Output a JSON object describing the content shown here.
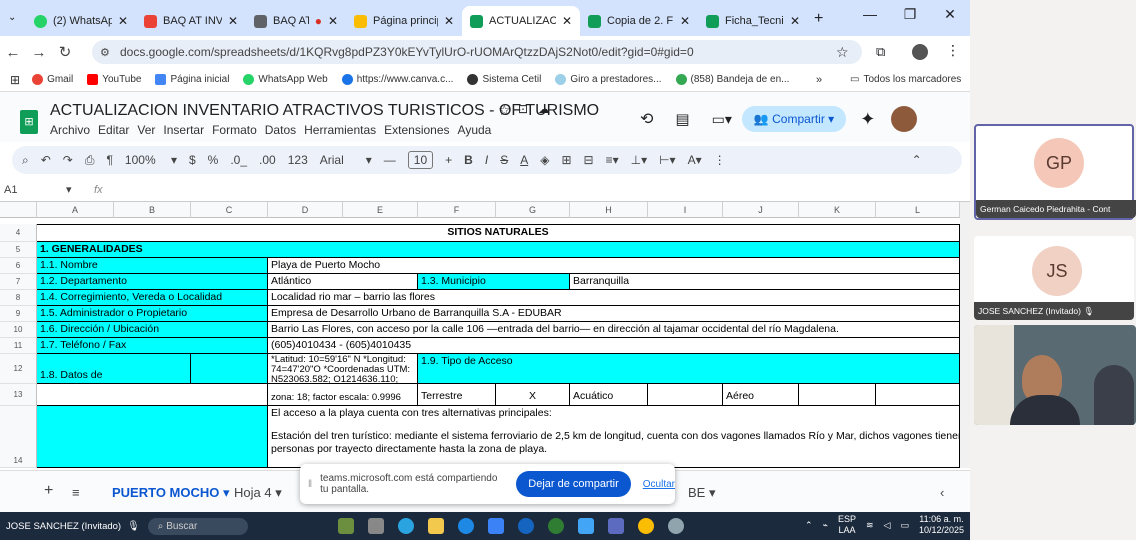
{
  "tabs": [
    {
      "label": "(2) WhatsApp",
      "fav": "#25d366",
      "active": false
    },
    {
      "label": "BAQ AT INVE",
      "fav": "#ea4335",
      "active": false
    },
    {
      "label": "BAQ AT IN",
      "fav": "#5f6368",
      "active": false
    },
    {
      "label": "Página princip",
      "fav": "#fbbc04",
      "active": false
    },
    {
      "label": "ACTUALIZACI",
      "fav": "#0f9d58",
      "active": true
    },
    {
      "label": "Copia de 2. F",
      "fav": "#0f9d58",
      "active": false
    },
    {
      "label": "Ficha_Tecnica",
      "fav": "#0f9d58",
      "active": false
    }
  ],
  "address": {
    "url": "docs.google.com/spreadsheets/d/1KQRvg8pdPZ3Y0kEYvTylUrO-rUOMArQtzzDAjS2Not0/edit?gid=0#gid=0"
  },
  "bookmarks": [
    "Gmail",
    "YouTube",
    "Página inicial",
    "WhatsApp Web",
    "https://www.canva.c...",
    "Sistema Cetil",
    "Giro a prestadores...",
    "(858) Bandeja de en..."
  ],
  "bookmarks_all": "Todos los marcadores",
  "doc": {
    "title": "ACTUALIZACION INVENTARIO ATRACTIVOS TURISTICOS - OF TURISMO",
    "menus": [
      "Archivo",
      "Editar",
      "Ver",
      "Insertar",
      "Formato",
      "Datos",
      "Herramientas",
      "Extensiones",
      "Ayuda"
    ],
    "share": "Compartir"
  },
  "toolbar": {
    "zoom": "100%",
    "currency": "$",
    "percent": "%",
    "dec_less": ".0_",
    "dec_more": ".00",
    "format_123": "123",
    "font": "Arial",
    "font_size": "10"
  },
  "formula_bar": {
    "cell_ref": "A1",
    "fx": "fx"
  },
  "columns": [
    "A",
    "B",
    "C",
    "D",
    "E",
    "F",
    "G",
    "H",
    "I",
    "J",
    "K",
    "L"
  ],
  "rows": {
    "r4": {
      "num": "4",
      "text": "SITIOS NATURALES"
    },
    "r5": {
      "num": "5",
      "text": "1. GENERALIDADES"
    },
    "r6": {
      "num": "6",
      "label": "1.1. Nombre",
      "value": "Playa de Puerto Mocho"
    },
    "r7": {
      "num": "7",
      "label": "1.2. Departamento",
      "value": "Atlántico",
      "label2": "1.3. Municipio",
      "value2": "Barranquilla"
    },
    "r8": {
      "num": "8",
      "label": "1.4. Corregimiento, Vereda o Localidad",
      "value": "Localidad rio mar – barrio las flores"
    },
    "r9": {
      "num": "9",
      "label": "1.5. Administrador o Propietario",
      "value": "Empresa de Desarrollo Urbano de Barranquilla S.A - EDUBAR"
    },
    "r10": {
      "num": "10",
      "label": "1.6. Dirección / Ubicación",
      "value": "Barrio Las Flores, con acceso por la calle 106 —entrada del barrio— en dirección al tajamar occidental del río Magdalena."
    },
    "r11": {
      "num": "11",
      "label": "1.7. Teléfono / Fax",
      "value": "(605)4010434 - (605)4010435"
    },
    "r12": {
      "num": "12",
      "label": "1.8. Datos de Georreferenciación",
      "coords": "*Latitud: 10=59'16\" N *Longitud: 74=47'20\"O *Coordenadas UTM: N523063.582; O1214636.110;",
      "label2": "1.9. Tipo de Acceso"
    },
    "r13": {
      "num": "13",
      "coords2": "zona: 18; factor escala: 0.9996",
      "t1": "Terrestre",
      "mark": "X",
      "t2": "Acuático",
      "t3": "Aéreo"
    },
    "r14": {
      "num": "14",
      "line1": "El acceso a la playa cuenta con tres alternativas principales:",
      "line2": "Estación del tren turístico: mediante el sistema ferroviario de 2,5 km de longitud, cuenta con dos vagones llamados Río y Mar, dichos vagones tienen capac",
      "line3": "personas por trayecto directamente hasta la zona de playa."
    }
  },
  "sheet_tabs": {
    "active": "PUERTO MOCHO",
    "next": "Hoja 4",
    "other": "BE"
  },
  "share_bar": {
    "text": "teams.microsoft.com está compartiendo tu pantalla.",
    "stop": "Dejar de compartir",
    "hide": "Ocultar"
  },
  "taskbar": {
    "user": "JOSE SANCHEZ (Invitado)",
    "search": "Buscar",
    "lang1": "ESP",
    "lang2": "LAA",
    "time": "11:06 a. m.",
    "date": "10/12/2025"
  },
  "participants": [
    {
      "initials": "GP",
      "name": "German Caicedo Piedrahita - Cont"
    },
    {
      "initials": "JS",
      "name": "JOSE SANCHEZ (Invitado)"
    }
  ]
}
